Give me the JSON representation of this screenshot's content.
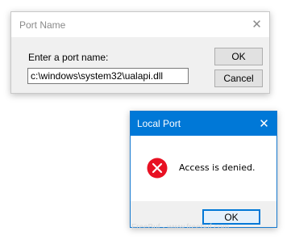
{
  "port_name_dialog": {
    "title": "Port Name",
    "close_glyph": "✕",
    "field_label": "Enter a port name:",
    "field_value": "c:\\windows\\system32\\ualapi.dll",
    "ok_label": "OK",
    "cancel_label": "Cancel"
  },
  "local_port_dialog": {
    "title": "Local Port",
    "close_glyph": "✕",
    "message": "Access is denied.",
    "ok_label": "OK",
    "icon": "error-icon",
    "accent_color": "#0078d7",
    "error_color": "#e81123"
  },
  "watermark": "FreeBuf · www.freebuf.com"
}
